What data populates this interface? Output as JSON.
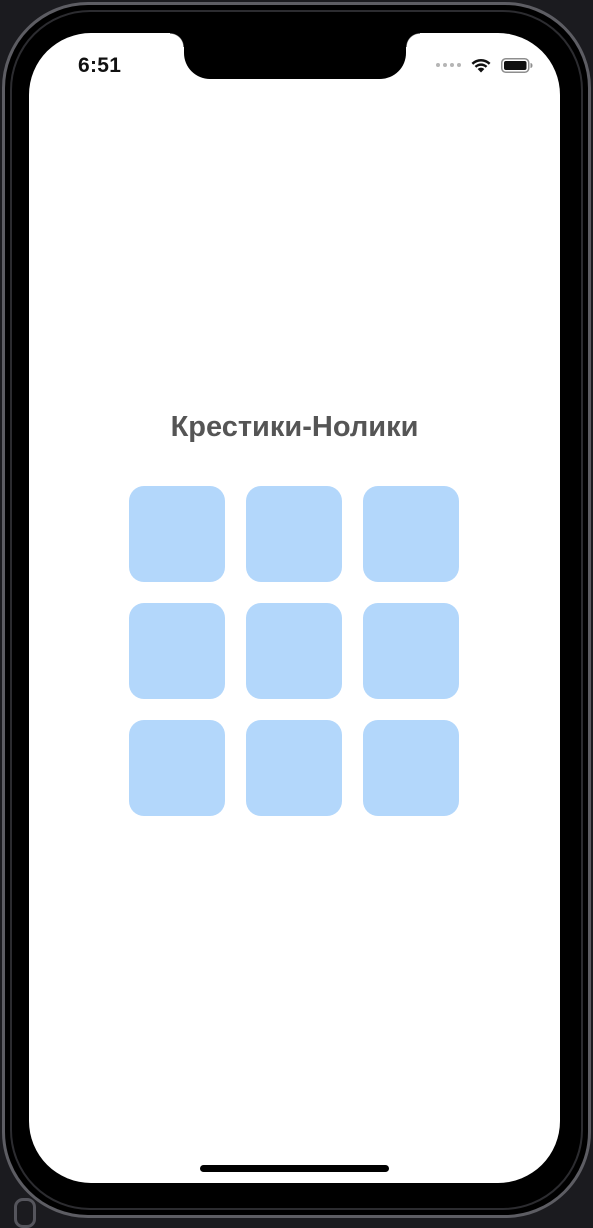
{
  "status_bar": {
    "time": "6:51",
    "icons": [
      "cellular-dots-icon",
      "wifi-icon",
      "battery-icon"
    ]
  },
  "screen": {
    "title": "Крестики-Нолики"
  },
  "board": {
    "rows": 3,
    "columns": 3,
    "cell_color": "#b3d7fb",
    "cells": [
      [
        "",
        "",
        ""
      ],
      [
        "",
        "",
        ""
      ],
      [
        "",
        "",
        ""
      ]
    ]
  },
  "colors": {
    "title": "#555555",
    "screen_background": "#ffffff",
    "device_frame": "#000000"
  }
}
